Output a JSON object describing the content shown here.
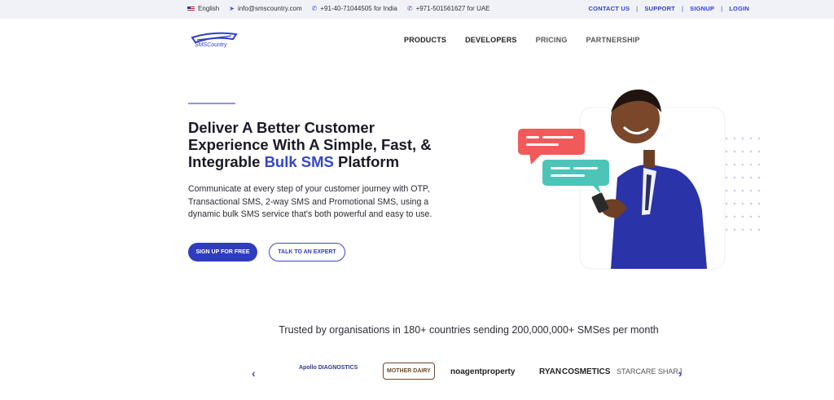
{
  "topbar": {
    "language": "English",
    "email": "info@smscountry.com",
    "phone_india": "+91-40-71044505 for India",
    "phone_uae": "+971-501561627 for UAE",
    "links": [
      "CONTACT US",
      "SUPPORT",
      "SIGNUP",
      "LOGIN"
    ]
  },
  "brand": {
    "name": "SMSCountry"
  },
  "nav": {
    "items": [
      "PRODUCTS",
      "DEVELOPERS",
      "PRICING",
      "PARTNERSHIP"
    ]
  },
  "hero": {
    "headline_part1": "Deliver A Better Customer Experience With A Simple, Fast, & Integrable ",
    "headline_highlight": "Bulk SMS",
    "headline_part2": " Platform",
    "subtext": "Communicate at every step of your customer journey with OTP, Transactional SMS, 2-way SMS and Promotional SMS, using a dynamic bulk SMS service that's both powerful and easy to use.",
    "cta_primary": "SIGN UP FOR FREE",
    "cta_secondary": "TALK TO AN EXPERT"
  },
  "trusted": {
    "title": "Trusted by organisations in 180+ countries sending 200,000,000+ SMSes per month",
    "logos": [
      "Apollo DIAGNOSTICS",
      "MOTHER DAIRY",
      "noagentproperty",
      "RYAN",
      "COSMETICS",
      "STARCARE SHARJ"
    ]
  },
  "colors": {
    "accent": "#2f3cbd",
    "topbar_bg": "#f1f2f8",
    "bubble_red": "#f05a5a",
    "bubble_teal": "#4cc4b8"
  }
}
